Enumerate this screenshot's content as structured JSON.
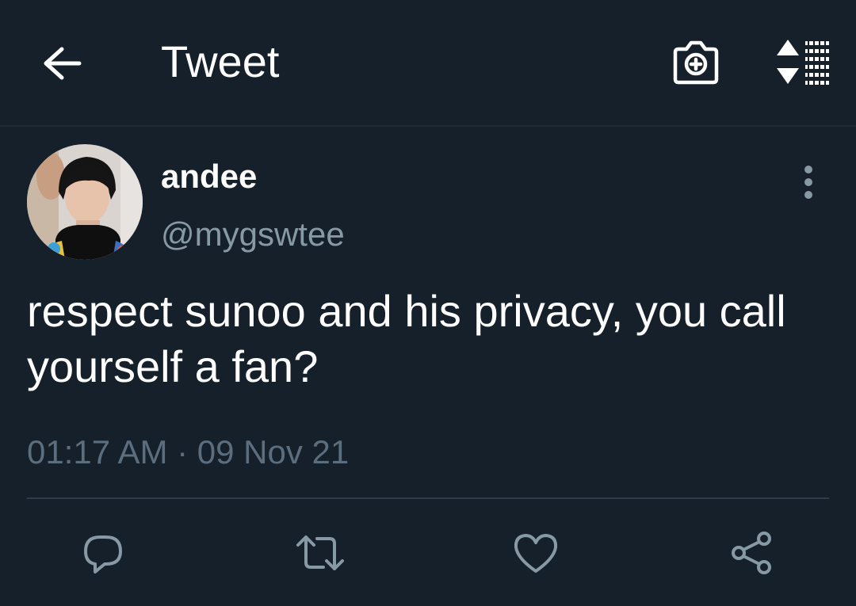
{
  "header": {
    "title": "Tweet",
    "icons": [
      "back-arrow-icon",
      "camera-add-icon",
      "sort-list-icon"
    ]
  },
  "tweet": {
    "author_name": "andee",
    "author_handle": "@mygswtee",
    "text": "respect sunoo and his privacy, you call yourself a fan?",
    "timestamp": "01:17 AM · 09 Nov 21"
  },
  "actions": [
    "reply-icon",
    "retweet-icon",
    "like-icon",
    "share-icon"
  ],
  "colors": {
    "background": "#15202b",
    "primary_text": "#ffffff",
    "secondary_text": "#8899a6",
    "icon": "#8899a6",
    "divider": "#2f3d4a"
  }
}
